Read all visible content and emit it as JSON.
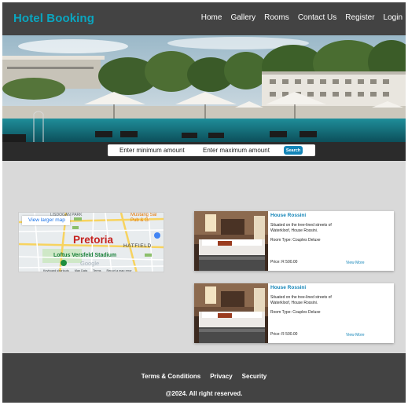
{
  "header": {
    "brand": "Hotel Booking",
    "nav": [
      "Home",
      "Gallery",
      "Rooms",
      "Contact Us",
      "Register",
      "Login"
    ]
  },
  "search": {
    "min_placeholder": "Enter minimum amount",
    "max_placeholder": "Enter maximum amount",
    "button_label": "Search"
  },
  "map": {
    "view_larger": "View larger map",
    "city": "Pretoria",
    "park": "LISDOGAN PARK",
    "mustang": "Mustang Sal",
    "pub": "Pub & Gr",
    "hatfield": "HATFIELD",
    "stadium": "Loftus Versfeld Stadium",
    "google": "Google",
    "footer": [
      "Keyboard shortcuts",
      "Map Data",
      "Terms",
      "Report a map error"
    ]
  },
  "listings": [
    {
      "title": "House Rossini",
      "description": "Situated on the tree-lined streets of Waterkloof, House Rossini.",
      "room_type": "Room Type: Couples Deluxe",
      "price": "Price: R 500.00",
      "link": "View More"
    },
    {
      "title": "House Rossini",
      "description": "Situated on the tree-lined streets of Waterkloof, House Rossini.",
      "room_type": "Room Type: Couples Deluxe",
      "price": "Price: R 500.00",
      "link": "View More"
    }
  ],
  "footer": {
    "links": [
      "Terms & Conditions",
      "Privacy",
      "Security"
    ],
    "copyright": "@2024. All right reserved."
  },
  "colors": {
    "brand": "#0aa6c0",
    "header_bg": "#434343",
    "page_bg": "#d9d9d9",
    "accent": "#1485b8"
  }
}
